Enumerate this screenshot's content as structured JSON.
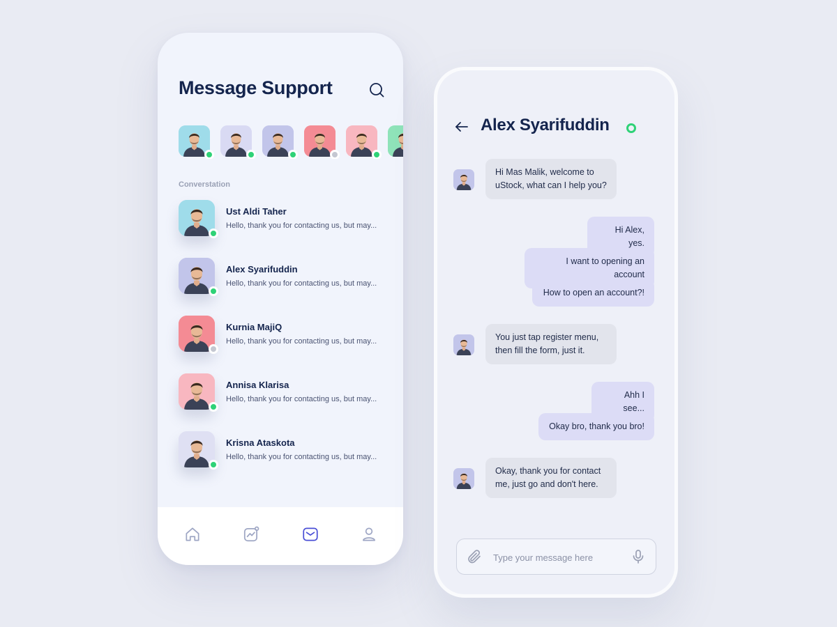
{
  "colors": {
    "online": "#2fd277",
    "offline": "#c4c7d1",
    "title": "#14244d",
    "bubble_in": "#e2e4ec",
    "bubble_out": "#dcdcf6",
    "nav_active": "#4a4fd6"
  },
  "left": {
    "title": "Message Support",
    "search_icon": "search-icon",
    "stories": [
      {
        "bg": "#9fdcea",
        "status": "online"
      },
      {
        "bg": "#d9daf3",
        "status": "online"
      },
      {
        "bg": "#c2c5ea",
        "status": "online"
      },
      {
        "bg": "#f48b94",
        "status": "offline"
      },
      {
        "bg": "#f8b7c0",
        "status": "online"
      },
      {
        "bg": "#8fe3b9",
        "status": "online"
      }
    ],
    "section_label": "Converstation",
    "conversations": [
      {
        "name": "Ust Aldi Taher",
        "preview": "Hello, thank you for contacting us, but may...",
        "bg": "#9fdcea",
        "status": "online"
      },
      {
        "name": "Alex Syarifuddin",
        "preview": "Hello, thank you for contacting us, but may...",
        "bg": "#c2c5ea",
        "status": "online"
      },
      {
        "name": "Kurnia MajiQ",
        "preview": "Hello, thank you for contacting us, but may...",
        "bg": "#f48b94",
        "status": "offline"
      },
      {
        "name": "Annisa Klarisa",
        "preview": "Hello, thank you for contacting us, but may...",
        "bg": "#f8b7c0",
        "status": "online"
      },
      {
        "name": "Krisna Ataskota",
        "preview": "Hello, thank you for contacting us, but may...",
        "bg": "#dfe0f3",
        "status": "online"
      }
    ],
    "nav": [
      {
        "icon": "home-icon",
        "active": false
      },
      {
        "icon": "chart-icon",
        "active": false
      },
      {
        "icon": "mail-icon",
        "active": true
      },
      {
        "icon": "user-icon",
        "active": false
      }
    ]
  },
  "right": {
    "title": "Alex Syarifuddin",
    "back_icon": "arrow-left-icon",
    "messages": [
      {
        "from": "agent",
        "lines": [
          "Hi Mas Malik, welcome to",
          "uStock, what can I help you?"
        ]
      },
      {
        "from": "user",
        "lines": [
          "Hi Alex, yes."
        ]
      },
      {
        "from": "user",
        "lines": [
          "I want to opening an account"
        ]
      },
      {
        "from": "user",
        "lines": [
          "How to open an account?!"
        ]
      },
      {
        "from": "agent",
        "lines": [
          "You just tap register menu,",
          "then fill the form, just it."
        ]
      },
      {
        "from": "user",
        "lines": [
          "Ahh I see..."
        ]
      },
      {
        "from": "user",
        "lines": [
          "Okay bro, thank you bro!"
        ]
      },
      {
        "from": "agent",
        "lines": [
          "Okay, thank you for contact",
          "me, just go and don't here."
        ]
      }
    ],
    "composer": {
      "placeholder": "Type your message here",
      "attach_icon": "paperclip-icon",
      "mic_icon": "microphone-icon"
    }
  }
}
